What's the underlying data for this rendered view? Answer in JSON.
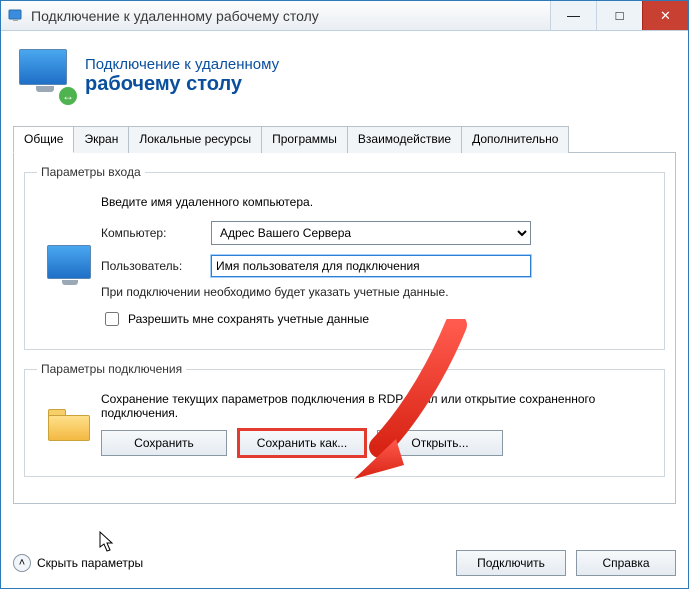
{
  "window": {
    "title": "Подключение к удаленному рабочему столу",
    "controls": {
      "minimize": "—",
      "maximize": "□",
      "close": "✕"
    }
  },
  "hero": {
    "line1": "Подключение к удаленному",
    "line2": "рабочему столу"
  },
  "tabs": [
    {
      "id": "general",
      "label": "Общие",
      "active": true
    },
    {
      "id": "display",
      "label": "Экран",
      "active": false
    },
    {
      "id": "local",
      "label": "Локальные ресурсы",
      "active": false
    },
    {
      "id": "programs",
      "label": "Программы",
      "active": false
    },
    {
      "id": "experience",
      "label": "Взаимодействие",
      "active": false
    },
    {
      "id": "advanced",
      "label": "Дополнительно",
      "active": false
    }
  ],
  "login_group": {
    "legend": "Параметры входа",
    "intro": "Введите имя удаленного компьютера.",
    "computer_label": "Компьютер:",
    "computer_value": "Адрес Вашего Сервера",
    "user_label": "Пользователь:",
    "user_value": "Имя пользователя для подключения",
    "cred_note": "При подключении необходимо будет указать учетные данные.",
    "allow_save_label": "Разрешить мне сохранять учетные данные"
  },
  "conn_group": {
    "legend": "Параметры подключения",
    "desc": "Сохранение текущих параметров подключения в RDP-файл или открытие сохраненного подключения.",
    "save": "Сохранить",
    "save_as": "Сохранить как...",
    "open": "Открыть..."
  },
  "footer": {
    "toggle_label": "Скрыть параметры",
    "connect": "Подключить",
    "help": "Справка"
  }
}
